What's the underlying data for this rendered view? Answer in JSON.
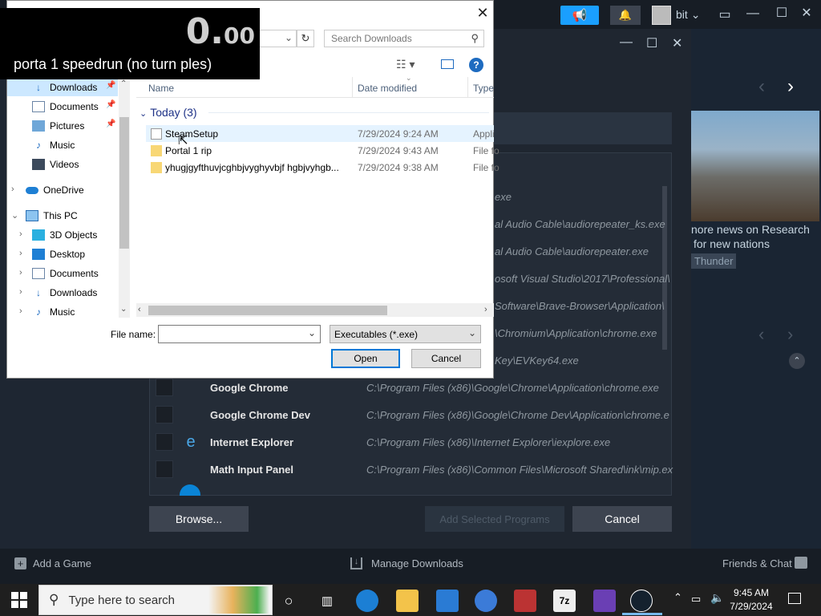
{
  "steam": {
    "username": "bit",
    "news": {
      "line1": "nore news on Research",
      "line2": "for new nations",
      "tag": "Thunder"
    },
    "programs": [
      {
        "name": "",
        "path": "exe"
      },
      {
        "name": "",
        "path": "al Audio Cable\\audiorepeater_ks.exe"
      },
      {
        "name": "",
        "path": "al Audio Cable\\audiorepeater.exe"
      },
      {
        "name": "",
        "path": "osoft Visual Studio\\2017\\Professional\\"
      },
      {
        "name": "",
        "path": "Software\\Brave-Browser\\Application\\"
      },
      {
        "name": "",
        "path": "\\Chromium\\Application\\chrome.exe"
      },
      {
        "name": "",
        "path": "Key\\EVKey64.exe"
      },
      {
        "name": "Google Chrome",
        "path": "C:\\Program Files (x86)\\Google\\Chrome\\Application\\chrome.exe"
      },
      {
        "name": "Google Chrome Dev",
        "path": "C:\\Program Files (x86)\\Google\\Chrome Dev\\Application\\chrome.e"
      },
      {
        "name": "Internet Explorer",
        "path": "C:\\Program Files (x86)\\Internet Explorer\\iexplore.exe"
      },
      {
        "name": "Math Input Panel",
        "path": "C:\\Program Files (x86)\\Common Files\\Microsoft Shared\\ink\\mip.ex"
      }
    ],
    "browse_label": "Browse...",
    "add_selected_label": "Add Selected Programs",
    "cancel_label": "Cancel",
    "bottom": {
      "add_game": "Add a Game",
      "manage_downloads": "Manage Downloads",
      "friends_chat": "Friends & Chat"
    }
  },
  "dialog": {
    "search_placeholder": "Search Downloads",
    "nav": [
      {
        "label": "Downloads",
        "pinned": true,
        "icon": "download-icon"
      },
      {
        "label": "Documents",
        "pinned": true,
        "icon": "documents-icon"
      },
      {
        "label": "Pictures",
        "pinned": true,
        "icon": "pictures-icon"
      },
      {
        "label": "Music",
        "pinned": false,
        "icon": "music-icon"
      },
      {
        "label": "Videos",
        "pinned": false,
        "icon": "videos-icon"
      },
      {
        "label": "OneDrive",
        "pinned": false,
        "icon": "onedrive-icon"
      },
      {
        "label": "This PC",
        "pinned": false,
        "icon": "this-pc-icon"
      },
      {
        "label": "3D Objects",
        "pinned": false,
        "icon": "3d-objects-icon"
      },
      {
        "label": "Desktop",
        "pinned": false,
        "icon": "desktop-icon"
      },
      {
        "label": "Documents",
        "pinned": false,
        "icon": "documents-icon"
      },
      {
        "label": "Downloads",
        "pinned": false,
        "icon": "download-icon"
      },
      {
        "label": "Music",
        "pinned": false,
        "icon": "music-icon"
      }
    ],
    "columns": {
      "name": "Name",
      "date": "Date modified",
      "type": "Type"
    },
    "group": "Today (3)",
    "files": [
      {
        "name": "SteamSetup",
        "date": "7/29/2024 9:24 AM",
        "type": "Appli",
        "kind": "app"
      },
      {
        "name": "Portal 1 rip",
        "date": "7/29/2024 9:43 AM",
        "type": "File fo",
        "kind": "folder"
      },
      {
        "name": "yhugjgyfthuvjcghbjvyghyvbjf hgbjvyhgb...",
        "date": "7/29/2024 9:38 AM",
        "type": "File fo",
        "kind": "folder"
      }
    ],
    "file_name_label": "File name:",
    "file_name_value": "",
    "file_type": "Executables (*.exe)",
    "open_label": "Open",
    "cancel_label": "Cancel"
  },
  "overlay": {
    "timer_main": "0.",
    "timer_frac": "00",
    "title": "porta 1 speedrun (no turn ples)"
  },
  "taskbar": {
    "search_placeholder": "Type here to search",
    "time": "9:45 AM",
    "date": "7/29/2024"
  }
}
